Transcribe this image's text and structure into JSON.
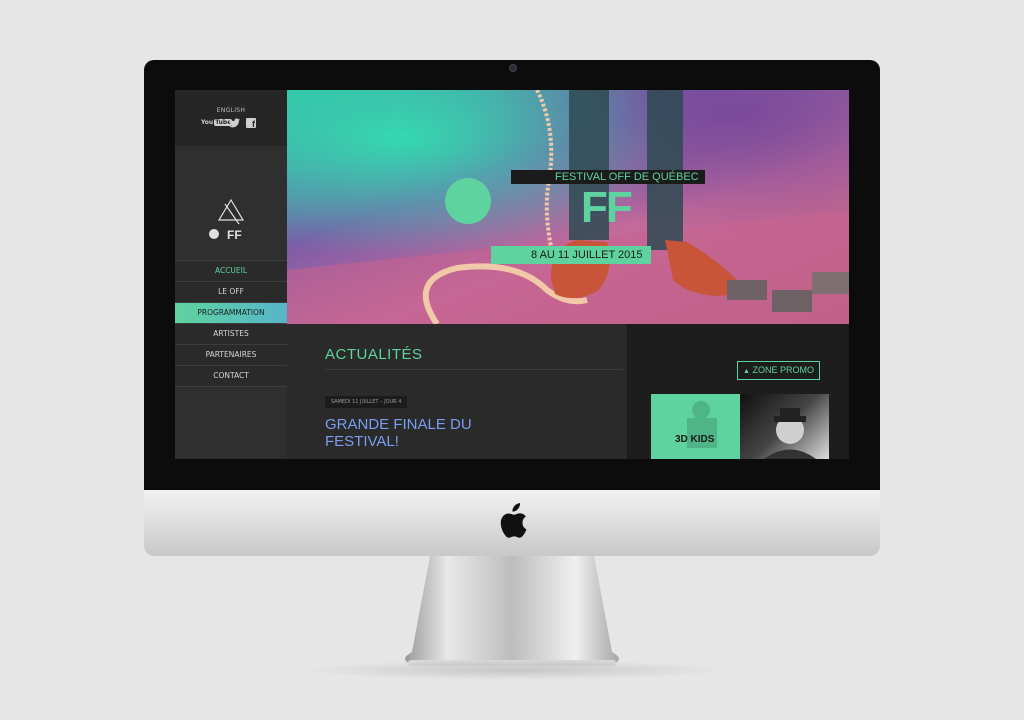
{
  "site": {
    "language_link": "ENGLISH",
    "social": {
      "youtube": "You",
      "youtube_tube": "Tube",
      "facebook": "f"
    }
  },
  "nav": {
    "items": [
      {
        "label": "ACCUEIL"
      },
      {
        "label": "LE OFF"
      },
      {
        "label": "PROGRAMMATION"
      },
      {
        "label": "ARTISTES"
      },
      {
        "label": "PARTENAIRES"
      },
      {
        "label": "CONTACT"
      }
    ]
  },
  "hero": {
    "title": "FESTIVAL OFF DE QUÉBEC",
    "logo_text": "FF",
    "dates": "8 AU 11 JUILLET 2015"
  },
  "news": {
    "heading": "ACTUALITÉS",
    "date": "SAMEDI 11 JUILLET – JOUR 4",
    "title": "GRANDE FINALE DU FESTIVAL!"
  },
  "promo": {
    "label": "ZONE PROMO",
    "arrow": "▲",
    "card_label": "3D KIDS"
  },
  "colors": {
    "accent": "#5fd39f",
    "link_blue": "#7b9cf0",
    "background": "#2b2b2b"
  }
}
